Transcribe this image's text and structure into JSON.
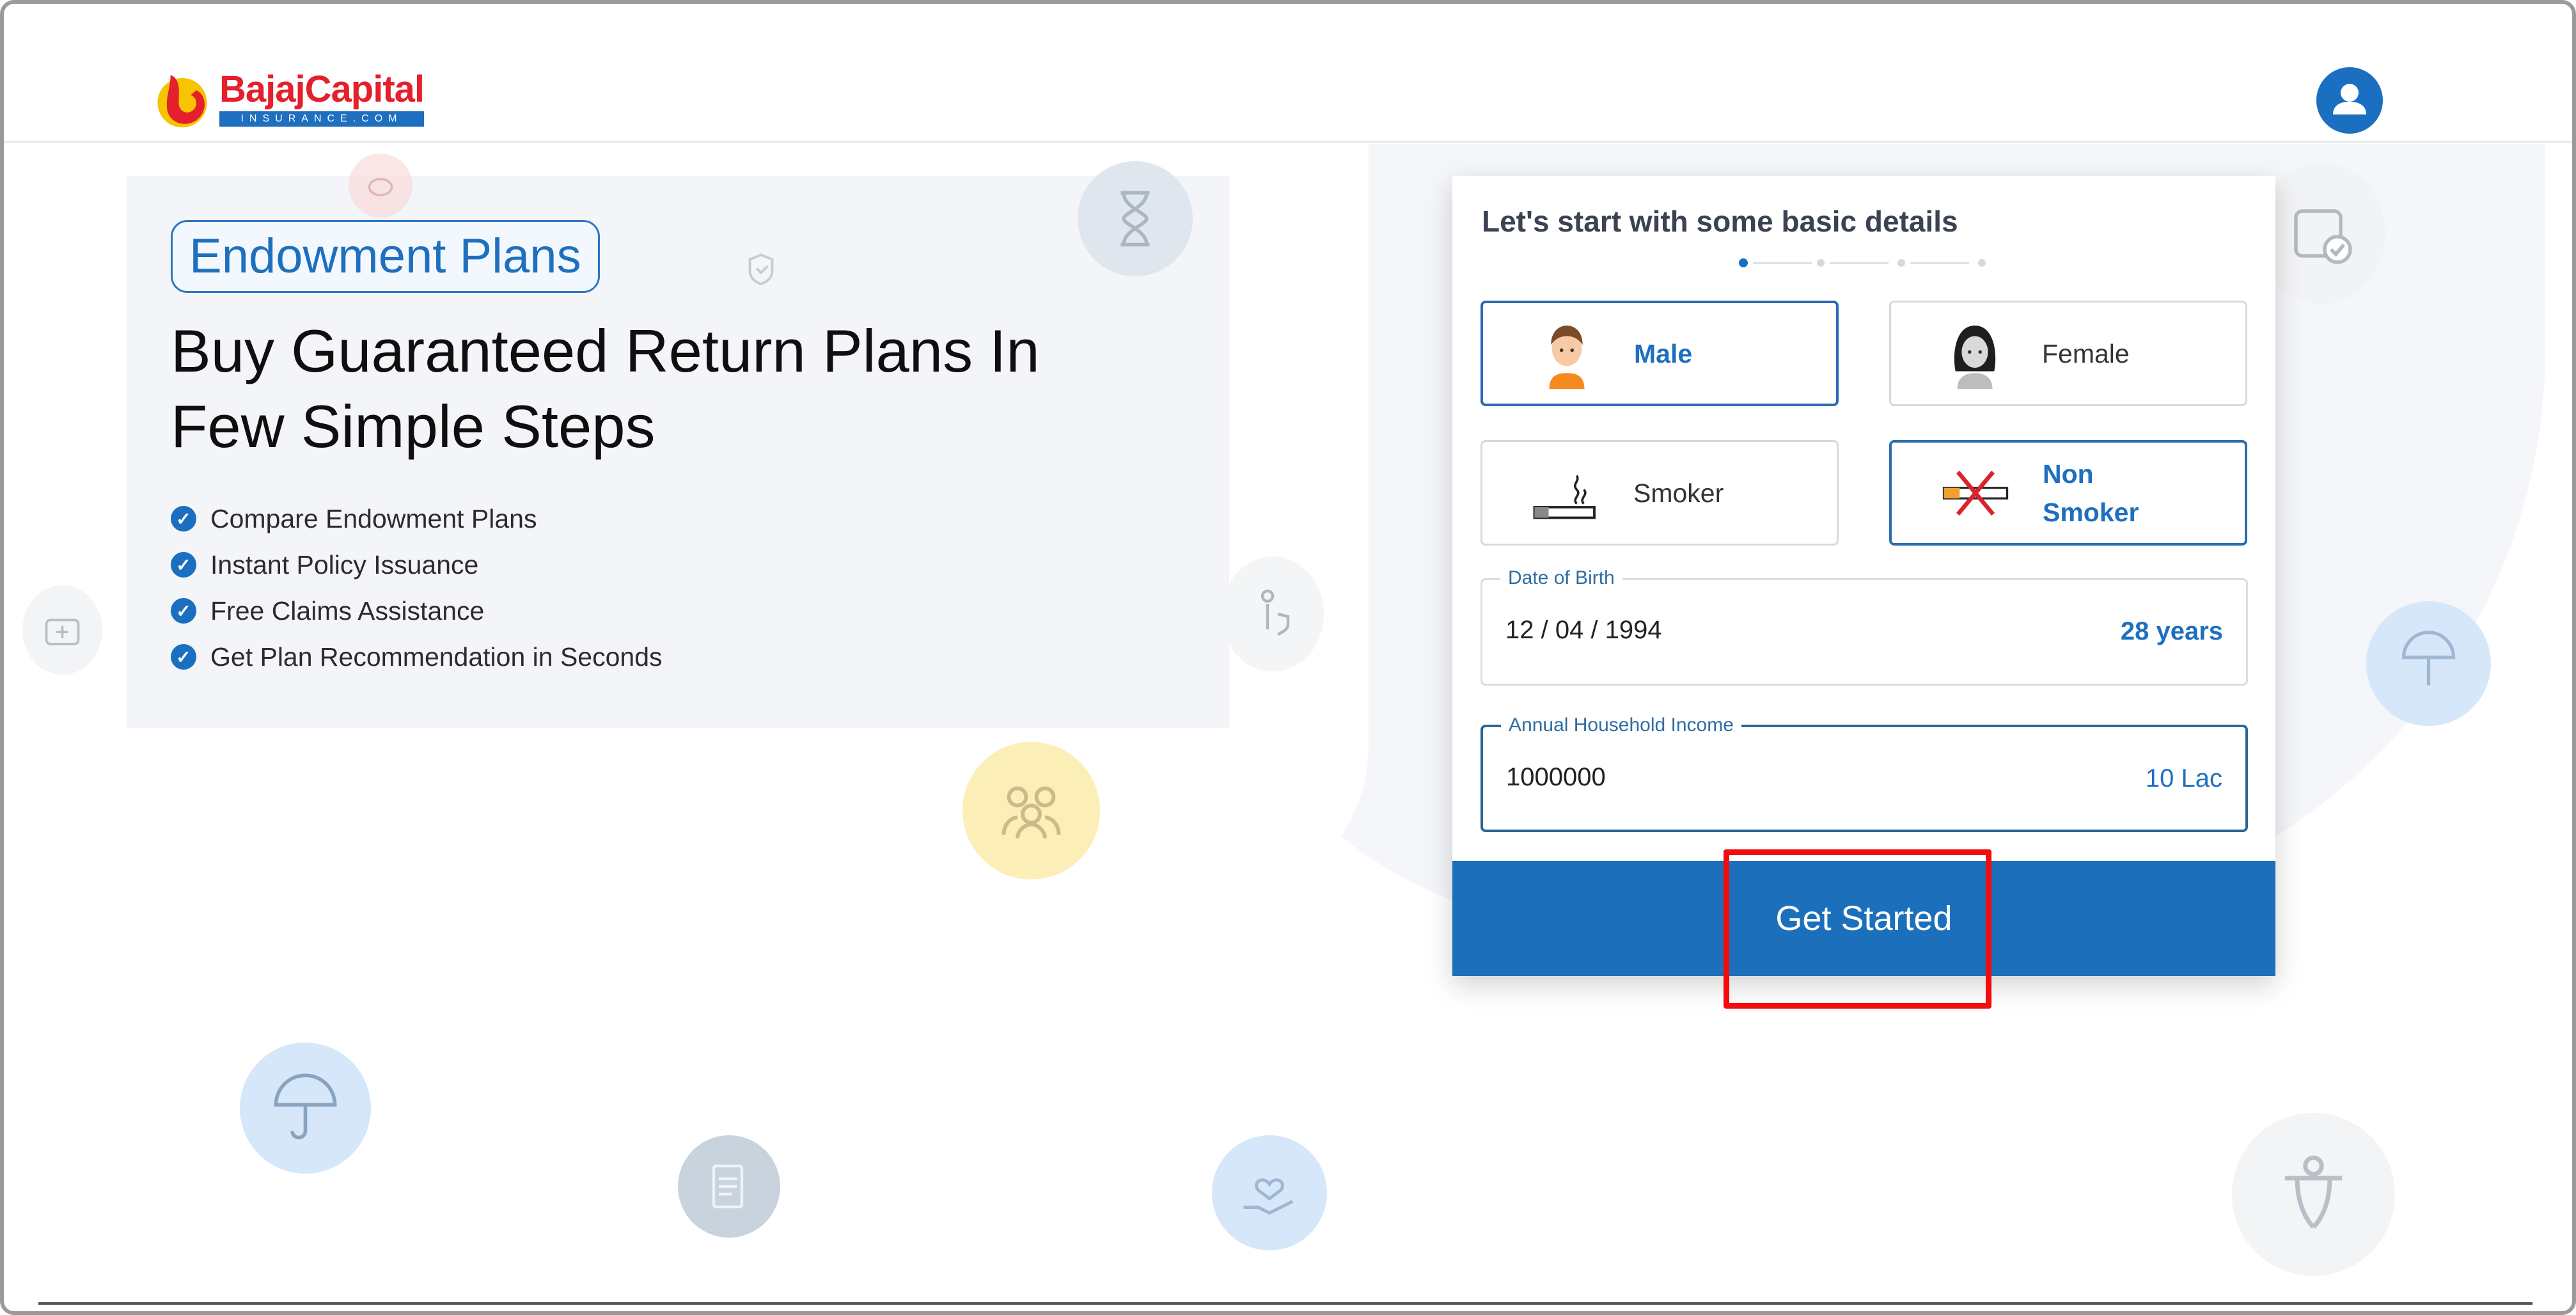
{
  "header": {
    "brand_name": "BajajCapital",
    "brand_sub": "INSURANCE.COM",
    "account_icon": "user-account-icon"
  },
  "hero": {
    "badge": "Endowment Plans",
    "headline_line1": "Buy Guaranteed Return Plans In",
    "headline_line2": "Few Simple Steps",
    "bullets": [
      "Compare Endowment Plans",
      "Instant Policy Issuance",
      "Free Claims Assistance",
      "Get Plan Recommendation in Seconds"
    ],
    "bullet_icon": "check-circle-icon"
  },
  "form": {
    "title": "Let's start with some basic details",
    "stepper": {
      "total_steps": 4,
      "current_step": 1
    },
    "gender": {
      "options": [
        {
          "label": "Male",
          "icon": "male-avatar-icon",
          "selected": true
        },
        {
          "label": "Female",
          "icon": "female-avatar-icon",
          "selected": false
        }
      ]
    },
    "smoking": {
      "options": [
        {
          "label": "Smoker",
          "icon": "cigarette-icon",
          "selected": false
        },
        {
          "label_line1": "Non",
          "label_line2": "Smoker",
          "icon": "no-smoking-icon",
          "selected": true
        }
      ]
    },
    "dob": {
      "label": "Date of Birth",
      "value": "12 / 04 / 1994",
      "suffix": "28 years"
    },
    "income": {
      "label": "Annual Household Income",
      "value": "1000000",
      "suffix": "10 Lac"
    },
    "submit_label": "Get Started"
  },
  "colors": {
    "brand_blue": "#1c70bb",
    "brand_red": "#e3202b",
    "brand_yellow": "#f6c400",
    "annotation_red": "#f20c0c"
  },
  "decorative_icons": [
    "piggy-bank-icon",
    "hourglass-icon",
    "shield-hands-icon",
    "calendar-check-icon",
    "medical-kit-icon",
    "person-shield-icon",
    "umbrella-person-icon",
    "family-icon",
    "umbrella-heart-icon",
    "document-shield-icon",
    "hand-heart-icon",
    "person-care-icon"
  ]
}
